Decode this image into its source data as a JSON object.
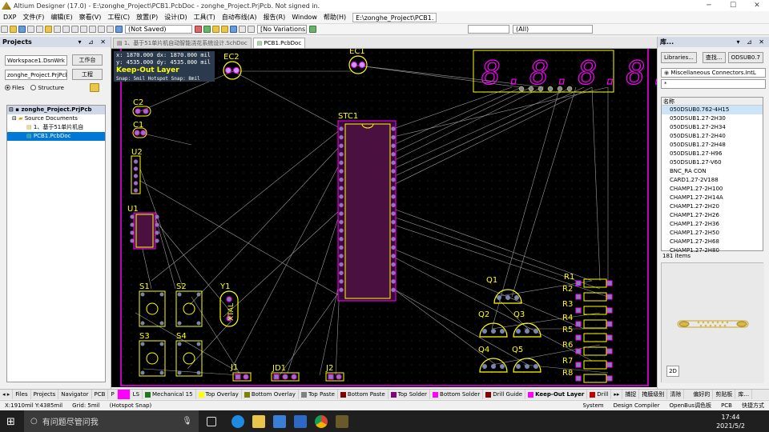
{
  "window": {
    "title": "Altium Designer (17.0) - E:\\zonghe_Project\\PCB1.PcbDoc - zonghe_Project.PrjPcb. Not signed in."
  },
  "menu": {
    "items": [
      "DXP",
      "文件(F)",
      "编辑(E)",
      "察看(V)",
      "工程(C)",
      "放置(P)",
      "设计(D)",
      "工具(T)",
      "自动布线(A)",
      "报告(R)",
      "Window",
      "帮助(H)"
    ],
    "path": "E:\\zonghe_Project\\PCB1.",
    "saved": "(Not Saved)",
    "variations": "[No Variations",
    "all": "(All)"
  },
  "projects": {
    "title": "Projects",
    "workspace": "Workspace1.DsnWrk",
    "workspace_btn": "工作台",
    "project": "zonghe_Project.PrjPcb",
    "project_btn": "工程",
    "files_label": "Files",
    "structure_label": "Structure",
    "tree": [
      "zonghe_Project.PrjPcb",
      "Source Documents",
      "1、基于51单片机自",
      "PCB1.PcbDoc"
    ]
  },
  "tabs": [
    "1、基于51单片机自动智能浇花系统设计.SchDoc",
    "PCB1.PcbDoc"
  ],
  "hud": {
    "line1": "x: 1870.000  dx: 1870.000 mil",
    "line2": "y: 4535.000  dy: 4535.000 mil",
    "layer": "Keep-Out Layer",
    "snap": "Snap: 5mil Hotspot Snap: 8mil"
  },
  "pcb": {
    "labels": {
      "ec2": "EC2",
      "ec1": "EC1",
      "c2": "C2",
      "c1": "C1",
      "u2": "U2",
      "u1": "U1",
      "stc": "STC1",
      "s1": "S1",
      "s2": "S2",
      "s3": "S3",
      "s4": "S4",
      "y1": "Y1",
      "xtal": "XTAL",
      "j1": "J1",
      "jd1": "JD1",
      "j2": "J2",
      "q1": "Q1",
      "q2": "Q2",
      "q3": "Q3",
      "q4": "Q4",
      "q5": "Q5",
      "r1": "R1",
      "r2": "R2",
      "r3": "R3",
      "r4": "R4",
      "r5": "R5",
      "r6": "R6",
      "r7": "R7",
      "r8": "R8",
      "seg": "8.8.8.8."
    }
  },
  "library": {
    "title": "库...",
    "btn_libraries": "Libraries...",
    "btn_search": "查找...",
    "btn_place": "ODSUB0.7",
    "lib": "Miscellaneous Connectors.IntL",
    "filter": "*",
    "col": "名称",
    "items": [
      "050DSUB0.762-4H15",
      "050DSUB1.27-2H30",
      "050DSUB1.27-2H34",
      "050DSUB1.27-2H40",
      "050DSUB1.27-2H48",
      "050DSUB1.27-H96",
      "050DSUB1.27-V60",
      "BNC_RA CON",
      "CARD1.27-2V188",
      "CHAMP1.27-2H100",
      "CHAMP1.27-2H14A",
      "CHAMP1.27-2H20",
      "CHAMP1.27-2H26",
      "CHAMP1.27-2H36",
      "CHAMP1.27-2H50",
      "CHAMP1.27-2H68",
      "CHAMP1.27-2H80"
    ],
    "count": "181 items",
    "view2d": "2D"
  },
  "layers": {
    "left_tabs": [
      "Files",
      "Projects",
      "Navigator",
      "PCB",
      "P"
    ],
    "ls": "LS",
    "items": [
      {
        "name": "Mechanical 15",
        "color": "#1c7a1c"
      },
      {
        "name": "Top Overlay",
        "color": "#ffff00"
      },
      {
        "name": "Bottom Overlay",
        "color": "#808000"
      },
      {
        "name": "Top Paste",
        "color": "#808080"
      },
      {
        "name": "Bottom Paste",
        "color": "#800000"
      },
      {
        "name": "Top Solder",
        "color": "#800080"
      },
      {
        "name": "Bottom Solder",
        "color": "#ff00ff"
      },
      {
        "name": "Drill Guide",
        "color": "#800000"
      },
      {
        "name": "Keep-Out Layer",
        "color": "#ff00ff"
      },
      {
        "name": "Drill",
        "color": "#c00000"
      }
    ],
    "right": [
      "捕捉",
      "掩膜级别",
      "清除",
      "偏好的",
      "剪贴板",
      "库..."
    ]
  },
  "status": {
    "coords": "X:1910mil Y:4385mil",
    "grid": "Grid: 5mil",
    "snap": "(Hotspot Snap)",
    "system": "System",
    "compiler": "Design Compiler",
    "openbus": "OpenBus调色板",
    "pcb": "PCB",
    "fast": "快捷方式"
  },
  "taskbar": {
    "search": "有问题尽管问我",
    "time": "17:44",
    "date": "2021/5/2"
  }
}
